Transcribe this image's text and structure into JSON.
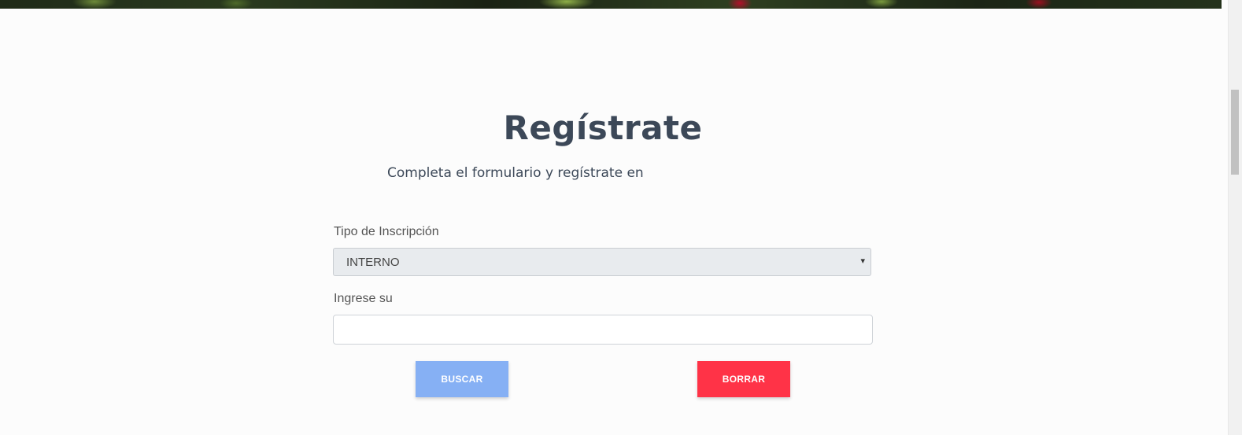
{
  "form": {
    "title": "Regístrate",
    "subtitle": "Completa el formulario y regístrate en",
    "tipo_label": "Tipo de Inscripción",
    "tipo_selected": "INTERNO",
    "ingrese_label": "Ingrese su",
    "input_value": "",
    "buscar_label": "BUSCAR",
    "borrar_label": "BORRAR"
  },
  "icons": {
    "select_arrow": "chevron-down-icon",
    "select_arrow_glyph": "▾"
  },
  "colors": {
    "title": "#3c4858",
    "buscar_button": "#86b0f4",
    "borrar_button": "#ff3347",
    "select_background": "#e8ebee"
  }
}
